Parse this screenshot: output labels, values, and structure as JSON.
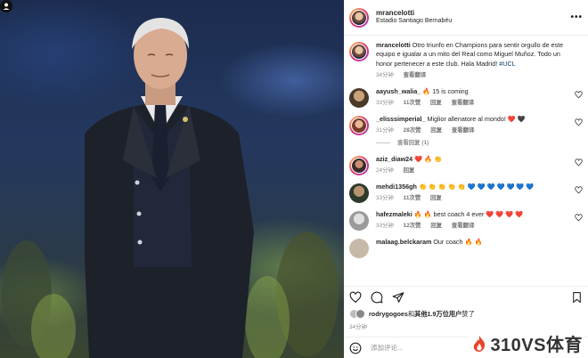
{
  "post": {
    "username": "mrancelotti",
    "location": "Estadio Santiago Bernabéu",
    "caption_text": "Otro triunfo en Champions para sentir orgullo de este equipo e igualar a un mito del Real como Miguel Muñoz. Todo un honor pertenecer a este club. Hala Madrid! ",
    "caption_tag": "#UCL",
    "caption_time": "34分钟",
    "caption_translate": "查看翻译",
    "likes_prefix": "rodrygogoes",
    "likes_mid": "和",
    "likes_bold": "其他1.9万位用户",
    "likes_suffix": "赞了",
    "time": "34分钟",
    "add_comment_placeholder": "添加评论..."
  },
  "comments": [
    {
      "user": "aayush_walia_",
      "text": "🔥 15 is coming",
      "time": "33分钟",
      "likes": "11次赞",
      "reply": "回复",
      "translate": "查看翻译"
    },
    {
      "user": "_elisssimperial_",
      "text": "Miglior allenatore al mondo! ❤️ 🖤",
      "time": "31分钟",
      "likes": "28次赞",
      "reply": "回复",
      "translate": "查看翻译",
      "view_replies": "查看回复 (1)"
    },
    {
      "user": "aziz_diaw24",
      "text": "❤️ 🔥 👏",
      "time": "24分钟",
      "reply": "回复"
    },
    {
      "user": "mehdi1356gh",
      "text": "👏 👏 👏 👏 👏 💙 💙 💙 💙 💙 💙 💙",
      "time": "33分钟",
      "likes": "11次赞",
      "reply": "回复"
    },
    {
      "user": "hafezmaleki",
      "text": "🔥 🔥 best coach 4 ever ❤️ ❤️ ❤️ ❤️",
      "time": "33分钟",
      "likes": "12次赞",
      "reply": "回复",
      "translate": "查看翻译"
    },
    {
      "user": "malaag.belckaram",
      "text": "Our coach 🔥 🔥",
      "time": "",
      "reply": ""
    }
  ],
  "watermark": "310VS体育",
  "colors": {
    "link": "#00376b",
    "meta": "#8e8e8e",
    "heart": "#ed4956"
  }
}
